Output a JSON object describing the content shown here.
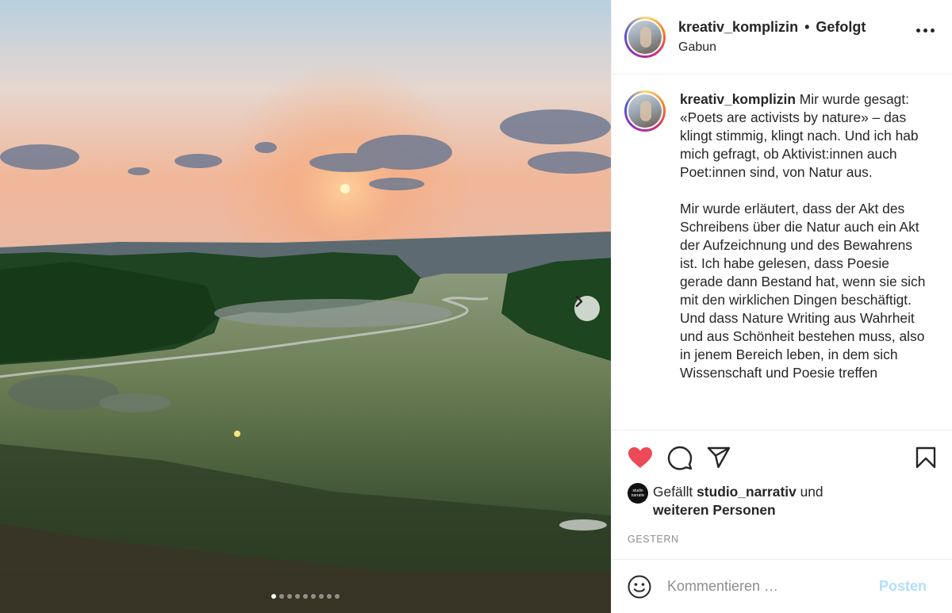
{
  "post": {
    "media": {
      "image_description_icon": "landscape-photo",
      "slides_total": 9,
      "current_slide": 1,
      "next_icon": "chevron-right-icon"
    },
    "header": {
      "username": "kreativ_komplizin",
      "separator": "•",
      "follow_state": "Gefolgt",
      "location": "Gabun",
      "more_icon": "more-horizontal-icon"
    },
    "caption": {
      "username": "kreativ_komplizin",
      "paragraph1": "Mir wurde gesagt: «Poets are activists by nature» – das klingt stimmig, klingt nach. Und ich hab mich gefragt, ob Aktivist:innen auch Poet:innen sind, von Natur aus.",
      "paragraph2": "Mir wurde erläutert, dass der Akt des Schreibens über die Natur auch ein Akt der Aufzeichnung und des Bewahrens ist. Ich habe gelesen, dass Poesie gerade dann Bestand hat, wenn sie sich mit den wirklichen Dingen beschäftigt. Und dass Nature Writing aus Wahrheit und aus Schönheit bestehen muss, also in jenem Bereich leben, in dem sich Wissenschaft und Poesie treffen"
    },
    "actions": {
      "like_icon": "heart-filled-icon",
      "comment_icon": "comment-icon",
      "share_icon": "send-icon",
      "save_icon": "bookmark-icon",
      "like_color": "#ed4956"
    },
    "likes": {
      "prefix": "Gefällt",
      "user": "studio_narrativ",
      "conjunction": "und",
      "others": "weiteren Personen",
      "mini_avatar_text": "studio narrativ"
    },
    "timestamp": "GESTERN",
    "comment": {
      "emoji_icon": "smiley-icon",
      "placeholder": "Kommentieren …",
      "post_label": "Posten",
      "post_color": "#b2dffc"
    }
  }
}
